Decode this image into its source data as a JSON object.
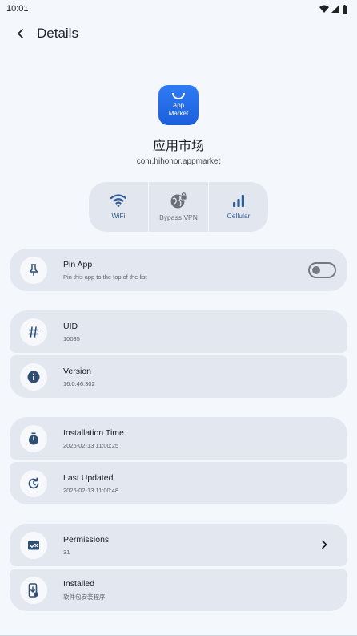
{
  "status": {
    "time": "10:01"
  },
  "header": {
    "title": "Details"
  },
  "app": {
    "icon_text_1": "App",
    "icon_text_2": "Market",
    "name": "应用市场",
    "package": "com.hihonor.appmarket"
  },
  "network": [
    {
      "label": "WiFi",
      "icon": "wifi-icon",
      "active": true
    },
    {
      "label": "Bypass VPN",
      "icon": "globe-lock-icon",
      "active": false
    },
    {
      "label": "Cellular",
      "icon": "cellular-icon",
      "active": true
    }
  ],
  "pin": {
    "title": "Pin App",
    "subtitle": "Pin this app to the top of the list",
    "enabled": false
  },
  "uid": {
    "title": "UID",
    "value": "10085"
  },
  "version": {
    "title": "Version",
    "value": "16.0.46.302"
  },
  "install_time": {
    "title": "Installation Time",
    "value": "2026-02-13 11:00:25"
  },
  "last_updated": {
    "title": "Last Updated",
    "value": "2026-02-13 11:00:48"
  },
  "permissions": {
    "title": "Permissions",
    "value": "31"
  },
  "installed": {
    "title": "Installed",
    "value": "软件包安装程序"
  },
  "colors": {
    "accent": "#2f5d94",
    "card": "#e3e7ef",
    "background": "#f4f7fb",
    "app_icon": "#2270ea"
  }
}
